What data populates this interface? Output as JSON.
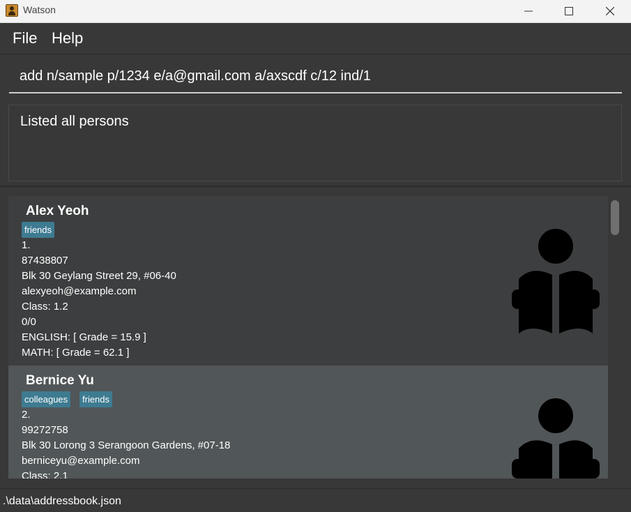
{
  "window": {
    "title": "Watson",
    "minimize_icon": "minimize-icon",
    "maximize_icon": "maximize-icon",
    "close_icon": "close-icon"
  },
  "menu": {
    "file": "File",
    "help": "Help"
  },
  "command": {
    "value": "add n/sample p/1234 e/a@gmail.com a/axscdf c/12 ind/1"
  },
  "result": {
    "text": "Listed all persons"
  },
  "persons": [
    {
      "name": "Alex Yeoh",
      "tags": [
        "friends"
      ],
      "index": "1.",
      "phone": "87438807",
      "address": "Blk 30 Geylang Street 29, #06-40",
      "email": "alexyeoh@example.com",
      "class": "Class: 1.2",
      "attendance": "0/0",
      "english": "ENGLISH: [ Grade = 15.9 ]",
      "math": "MATH: [ Grade = 62.1 ]",
      "icon": "student-reading-icon"
    },
    {
      "name": "Bernice Yu",
      "tags": [
        "colleagues",
        "friends"
      ],
      "index": "2.",
      "phone": "99272758",
      "address": "Blk 30 Lorong 3 Serangoon Gardens, #07-18",
      "email": "berniceyu@example.com",
      "class": "Class: 2.1",
      "icon": "student-reading-icon"
    }
  ],
  "status": {
    "path": ".\\data\\addressbook.json"
  },
  "colors": {
    "tag": "#3e7b91",
    "card_odd": "#3c3e3f",
    "card_even": "#515658",
    "background": "#383838"
  }
}
